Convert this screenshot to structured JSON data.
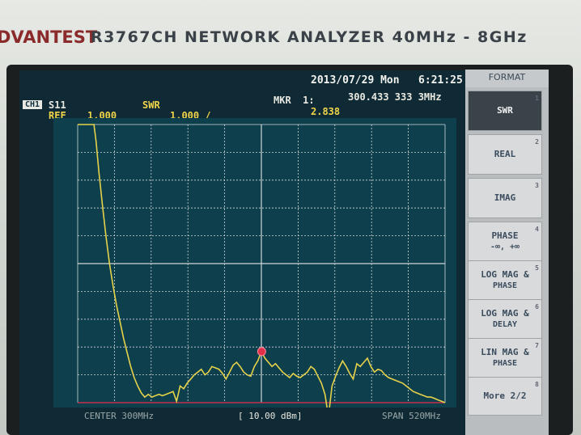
{
  "instrument": {
    "brand": "DVANTEST",
    "model": "R3767CH  NETWORK  ANALYZER  40MHz - 8GHz"
  },
  "header": {
    "datetime": "2013/07/29 Mon   6:21:25",
    "channel": "CH1",
    "param": "S11",
    "format": "SWR",
    "ref_label": "REF",
    "ref_value": "1.000",
    "scale": "1.000 /",
    "marker_label": "MKR  1:",
    "marker_freq": "300.433 333 3MHz",
    "marker_value": "2.838"
  },
  "status": {
    "center": "CENTER 300MHz",
    "power": "[ 10.00 dBm]",
    "span": "SPAN 520MHz"
  },
  "menu": {
    "title": "FORMAT",
    "keys": [
      {
        "label": "SWR",
        "sub": "",
        "num": "1"
      },
      {
        "label": "REAL",
        "sub": "",
        "num": "2"
      },
      {
        "label": "IMAG",
        "sub": "",
        "num": "3"
      },
      {
        "label": "PHASE",
        "sub": "-∞, +∞",
        "num": "4"
      },
      {
        "label": "LOG MAG &",
        "sub": "PHASE",
        "num": "5"
      },
      {
        "label": "LOG MAG &",
        "sub": "DELAY",
        "num": "6"
      },
      {
        "label": "LIN MAG &",
        "sub": "PHASE",
        "num": "7"
      },
      {
        "label": "More 2/2",
        "sub": "",
        "num": "8"
      }
    ]
  },
  "colors": {
    "trace": "#e6d24a",
    "grid": "#cfd8d8",
    "marker": "#e0304a"
  },
  "chart_data": {
    "type": "line",
    "title": "",
    "xlabel": "",
    "ylabel": "",
    "xlim": [
      40,
      560
    ],
    "ylim": [
      1,
      11
    ],
    "grid": true,
    "series": [
      {
        "x": [
          40,
          63,
          66,
          70,
          75,
          80,
          85,
          90,
          95,
          100,
          105,
          110,
          115,
          120,
          125,
          130,
          135,
          140,
          145,
          150,
          155,
          160,
          165,
          170,
          175,
          180,
          185,
          190,
          195,
          200,
          205,
          210,
          215,
          220,
          225,
          230,
          235,
          240,
          245,
          250,
          255,
          260,
          265,
          270,
          275,
          280,
          285,
          290,
          295,
          300,
          305,
          310,
          315,
          320,
          325,
          330,
          335,
          340,
          345,
          350,
          355,
          360,
          365,
          370,
          375,
          380,
          385,
          390,
          395,
          400,
          405,
          410,
          415,
          420,
          425,
          430,
          435,
          440,
          445,
          450,
          455,
          460,
          465,
          470,
          475,
          480,
          485,
          490,
          495,
          500,
          505,
          510,
          515,
          520,
          525,
          530,
          535,
          540,
          545,
          550,
          555,
          560
        ],
        "values": [
          11,
          11,
          10.4,
          9.3,
          8.1,
          7.0,
          6.0,
          5.2,
          4.5,
          3.9,
          3.3,
          2.8,
          2.3,
          1.9,
          1.6,
          1.35,
          1.2,
          1.3,
          1.2,
          1.25,
          1.3,
          1.25,
          1.3,
          1.35,
          1.4,
          1.05,
          1.6,
          1.5,
          1.7,
          1.85,
          2.0,
          2.1,
          2.2,
          2.0,
          2.1,
          2.3,
          2.25,
          2.2,
          2.05,
          1.85,
          2.1,
          2.35,
          2.45,
          2.3,
          2.1,
          2.0,
          1.95,
          2.3,
          2.5,
          2.84,
          2.6,
          2.45,
          2.3,
          2.4,
          2.25,
          2.1,
          2.0,
          1.9,
          2.05,
          1.95,
          1.9,
          2.0,
          2.1,
          2.3,
          2.2,
          1.95,
          1.7,
          1.3,
          0.5,
          1.6,
          1.95,
          2.25,
          2.5,
          2.3,
          2.05,
          1.85,
          2.4,
          2.3,
          2.45,
          2.6,
          2.3,
          2.1,
          2.2,
          2.15,
          2.0,
          1.9,
          1.85,
          1.8,
          1.75,
          1.7,
          1.6,
          1.5,
          1.4,
          1.35,
          1.3,
          1.25,
          1.2,
          1.2,
          1.15,
          1.1,
          1.05,
          1.0
        ]
      }
    ],
    "marker": {
      "x": 300.43,
      "y": 2.838
    }
  }
}
